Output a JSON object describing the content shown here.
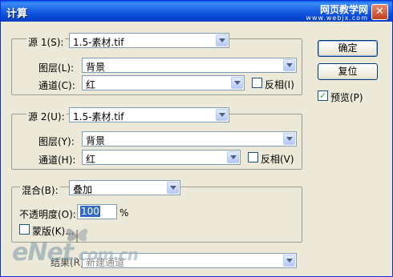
{
  "window": {
    "title": "计算",
    "close_glyph": "✕"
  },
  "watermark_top": {
    "site_name": "网页教学网",
    "url": "www.webjx.com"
  },
  "source1": {
    "label": "源 1(S):",
    "file": "1.5-素材.tif",
    "layer_label": "图层(L):",
    "layer_value": "背景",
    "channel_label": "通道(C):",
    "channel_value": "红",
    "invert_label": "反相(I)",
    "invert_checked": false
  },
  "source2": {
    "label": "源 2(U):",
    "file": "1.5-素材.tif",
    "layer_label": "图层(Y):",
    "layer_value": "背景",
    "channel_label": "通道(H):",
    "channel_value": "红",
    "invert_label": "反相(V)",
    "invert_checked": false
  },
  "blend": {
    "label": "混合(B):",
    "mode": "叠加",
    "opacity_label": "不透明度(O):",
    "opacity_value": "100",
    "opacity_unit": "%",
    "mask_label": "蒙版(K)...",
    "mask_checked": false
  },
  "result": {
    "label": "结果(R):",
    "value": "新建通道"
  },
  "buttons": {
    "ok": "确定",
    "reset": "复位"
  },
  "preview": {
    "label": "预览(P)",
    "checked": true,
    "check_glyph": "✓"
  },
  "watermark_bottom": {
    "brand": "eNet",
    "domain": ".com.cn"
  },
  "colors": {
    "titlebar": "#0a5fe8",
    "dialog_bg": "#ece9d8",
    "selection": "#316ac5"
  }
}
